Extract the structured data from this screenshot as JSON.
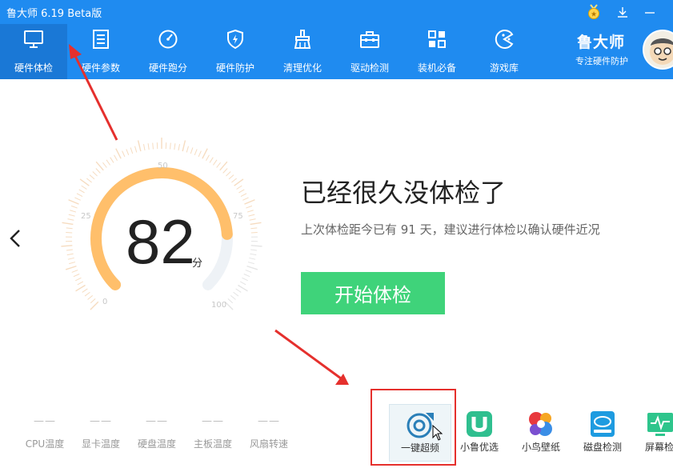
{
  "app": {
    "title": "鲁大师 6.19 Beta版",
    "brand_name": "鲁大师",
    "brand_slogan": "专注硬件防护"
  },
  "nav": {
    "items": [
      {
        "label": "硬件体检",
        "icon": "monitor-icon",
        "active": true
      },
      {
        "label": "硬件参数",
        "icon": "list-icon"
      },
      {
        "label": "硬件跑分",
        "icon": "speedometer-icon"
      },
      {
        "label": "硬件防护",
        "icon": "shield-icon"
      },
      {
        "label": "清理优化",
        "icon": "broom-icon"
      },
      {
        "label": "驱动检测",
        "icon": "toolbox-icon"
      },
      {
        "label": "装机必备",
        "icon": "apps-grid-icon"
      },
      {
        "label": "游戏库",
        "icon": "pacman-icon"
      }
    ]
  },
  "score": {
    "value": "82",
    "unit": "分",
    "max": 100,
    "ticks": [
      "0",
      "25",
      "50",
      "75",
      "100"
    ]
  },
  "checkup": {
    "headline": "已经很久没体检了",
    "message": "上次体检距今已有 91 天，建议进行体检以确认硬件近况",
    "start_button": "开始体检"
  },
  "temps": [
    {
      "value": "——",
      "label": "CPU温度"
    },
    {
      "value": "——",
      "label": "显卡温度"
    },
    {
      "value": "——",
      "label": "硬盘温度"
    },
    {
      "value": "——",
      "label": "主板温度"
    },
    {
      "value": "——",
      "label": "风扇转速"
    }
  ],
  "tools": [
    {
      "label": "一键超频",
      "icon": "overclock-icon",
      "selected": true
    },
    {
      "label": "小鲁优选",
      "icon": "u-logo-icon"
    },
    {
      "label": "小鸟壁纸",
      "icon": "bird-wallpaper-icon"
    },
    {
      "label": "磁盘检测",
      "icon": "disk-icon"
    },
    {
      "label": "屏幕检",
      "icon": "screen-check-icon"
    }
  ],
  "colors": {
    "primary": "#1f8bf0",
    "gauge_fill": "#ffbf6b",
    "start_button": "#3fd37a",
    "annotation": "#e5302d"
  }
}
